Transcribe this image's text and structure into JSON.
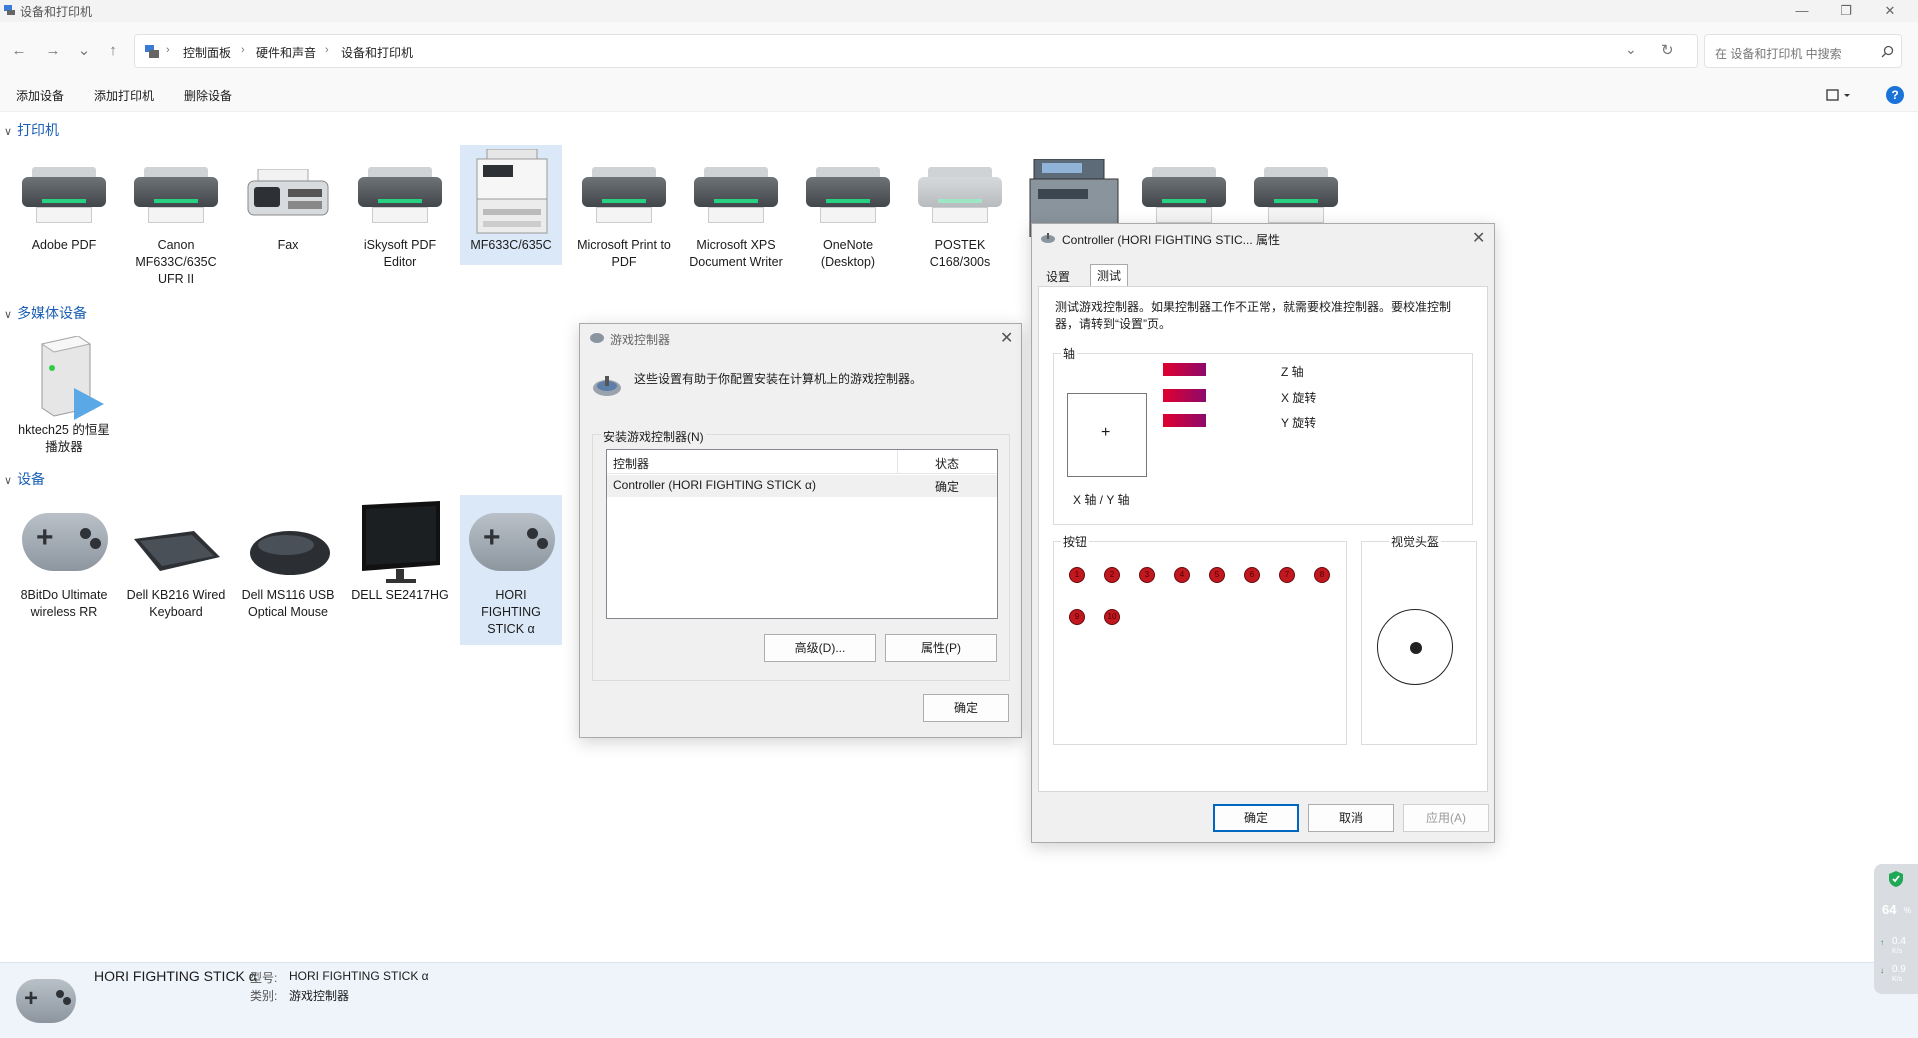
{
  "window": {
    "title": "设备和打印机",
    "minimize": "—",
    "restore": "❐",
    "close": "✕"
  },
  "nav": {
    "back": "←",
    "forward": "→",
    "recent": "⌄",
    "up": "↑",
    "refresh": "↻",
    "dropdown": "⌄"
  },
  "breadcrumb": [
    "控制面板",
    "硬件和声音",
    "设备和打印机"
  ],
  "search": {
    "placeholder": "在 设备和打印机 中搜索"
  },
  "commands": {
    "add_device": "添加设备",
    "add_printer": "添加打印机",
    "remove_device": "删除设备",
    "help": "?"
  },
  "groups": {
    "printers": "打印机",
    "multimedia": "多媒体设备",
    "devices": "设备"
  },
  "printers": [
    "Adobe PDF",
    "Canon MF633C/635C UFR II",
    "Fax",
    "iSkysoft PDF Editor",
    "MF633C/635C",
    "Microsoft Print to PDF",
    "Microsoft XPS Document Writer",
    "OneNote (Desktop)",
    "POSTEK C168/300s",
    "",
    "",
    ""
  ],
  "multimedia": [
    "hktech25 的恒星播放器"
  ],
  "devices": [
    "8BitDo Ultimate wireless RR",
    "Dell KB216 Wired Keyboard",
    "Dell MS116 USB Optical Mouse",
    "DELL SE2417HG",
    "HORI FIGHTING STICK α"
  ],
  "game_dialog": {
    "title": "游戏控制器",
    "description": "这些设置有助于你配置安装在计算机上的游戏控制器。",
    "group_label": "安装游戏控制器(N)",
    "col_controller": "控制器",
    "col_status": "状态",
    "row_name": "Controller (HORI FIGHTING STICK α)",
    "row_status": "确定",
    "advanced": "高级(D)...",
    "properties": "属性(P)",
    "ok": "确定",
    "close": "✕"
  },
  "props_dialog": {
    "title": "Controller (HORI FIGHTING STIC... 属性",
    "tab_settings": "设置",
    "tab_test": "测试",
    "description": "测试游戏控制器。如果控制器工作不正常，就需要校准控制器。要校准控制器，请转到“设置”页。",
    "axes_group": "轴",
    "xy_label": "X 轴 / Y 轴",
    "crosshair": "+",
    "axes": [
      {
        "label": "Z 轴",
        "value": 0.5
      },
      {
        "label": "X 旋转",
        "value": 0.5
      },
      {
        "label": "Y 旋转",
        "value": 0.5
      }
    ],
    "buttons_group": "按钮",
    "buttons": [
      "1",
      "2",
      "3",
      "4",
      "5",
      "6",
      "7",
      "8",
      "9",
      "10"
    ],
    "pov_group": "视觉头盔",
    "ok": "确定",
    "cancel": "取消",
    "apply": "应用(A)",
    "close": "✕"
  },
  "details": {
    "name": "HORI FIGHTING STICK α",
    "model_label": "型号:",
    "model_value": "HORI FIGHTING STICK α",
    "category_label": "类别:",
    "category_value": "游戏控制器"
  },
  "widget": {
    "cpu": "64",
    "cpu_unit": "%",
    "up": "0.4",
    "down": "0.9",
    "rate_unit": "K/s"
  },
  "colors": {
    "accent": "#0067c0",
    "group": "#1a5fb4",
    "selection": "#dbe8f8",
    "button_led": "#c0181e"
  }
}
